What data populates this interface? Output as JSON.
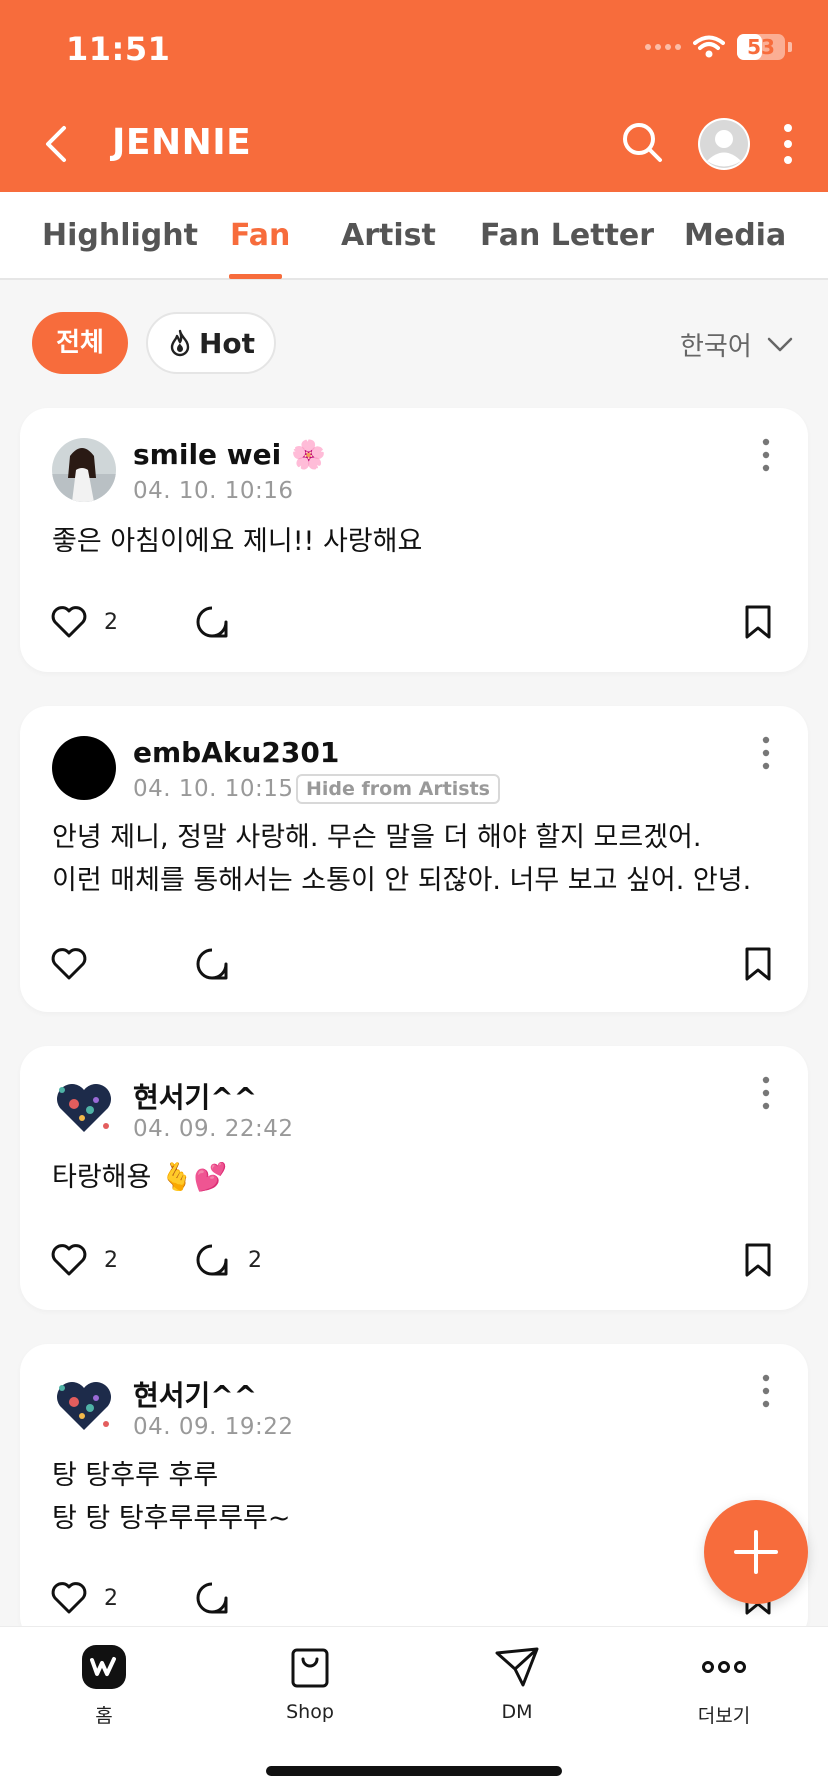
{
  "status_bar": {
    "time": "11:51",
    "battery": "53",
    "battery_level": 0.53
  },
  "header": {
    "title": "JENNIE"
  },
  "tabs": [
    {
      "label": "Highlight",
      "active": false
    },
    {
      "label": "Fan",
      "active": true
    },
    {
      "label": "Artist",
      "active": false
    },
    {
      "label": "Fan Letter",
      "active": false
    },
    {
      "label": "Media",
      "active": false
    }
  ],
  "filters": {
    "all_label": "전체",
    "hot_label": "Hot",
    "language": "한국어"
  },
  "posts": [
    {
      "name": "smile wei 🌸",
      "time": "04. 10. 10:16",
      "lines": [
        "좋은 아침이에요 제니!! 사랑해요"
      ],
      "likes": "2",
      "comments": ""
    },
    {
      "name": "embAku2301",
      "time": "04. 10. 10:15",
      "badge": "Hide from Artists",
      "lines": [
        "안녕 제니, 정말 사랑해. 무슨 말을 더 해야 할지 모르겠어.",
        "이런 매체를 통해서는 소통이 안 되잖아. 너무 보고 싶어. 안녕."
      ],
      "likes": "",
      "comments": ""
    },
    {
      "name": "현서기^^",
      "time": "04. 09. 22:42",
      "lines": [
        "타랑해용 🫰💕"
      ],
      "likes": "2",
      "comments": "2"
    },
    {
      "name": "현서기^^",
      "time": "04. 09. 19:22",
      "lines": [
        "탕 탕후루 후루",
        "탕 탕 탕후루루루루~"
      ],
      "likes": "2",
      "comments": ""
    }
  ],
  "bottom_nav": [
    {
      "label": "홈",
      "icon": "weverse-home-icon"
    },
    {
      "label": "Shop",
      "icon": "shop-bag-icon"
    },
    {
      "label": "DM",
      "icon": "dm-send-icon"
    },
    {
      "label": "더보기",
      "icon": "more-dots-icon"
    }
  ],
  "colors": {
    "accent": "#f76c3c",
    "background": "#f6f6f6"
  }
}
